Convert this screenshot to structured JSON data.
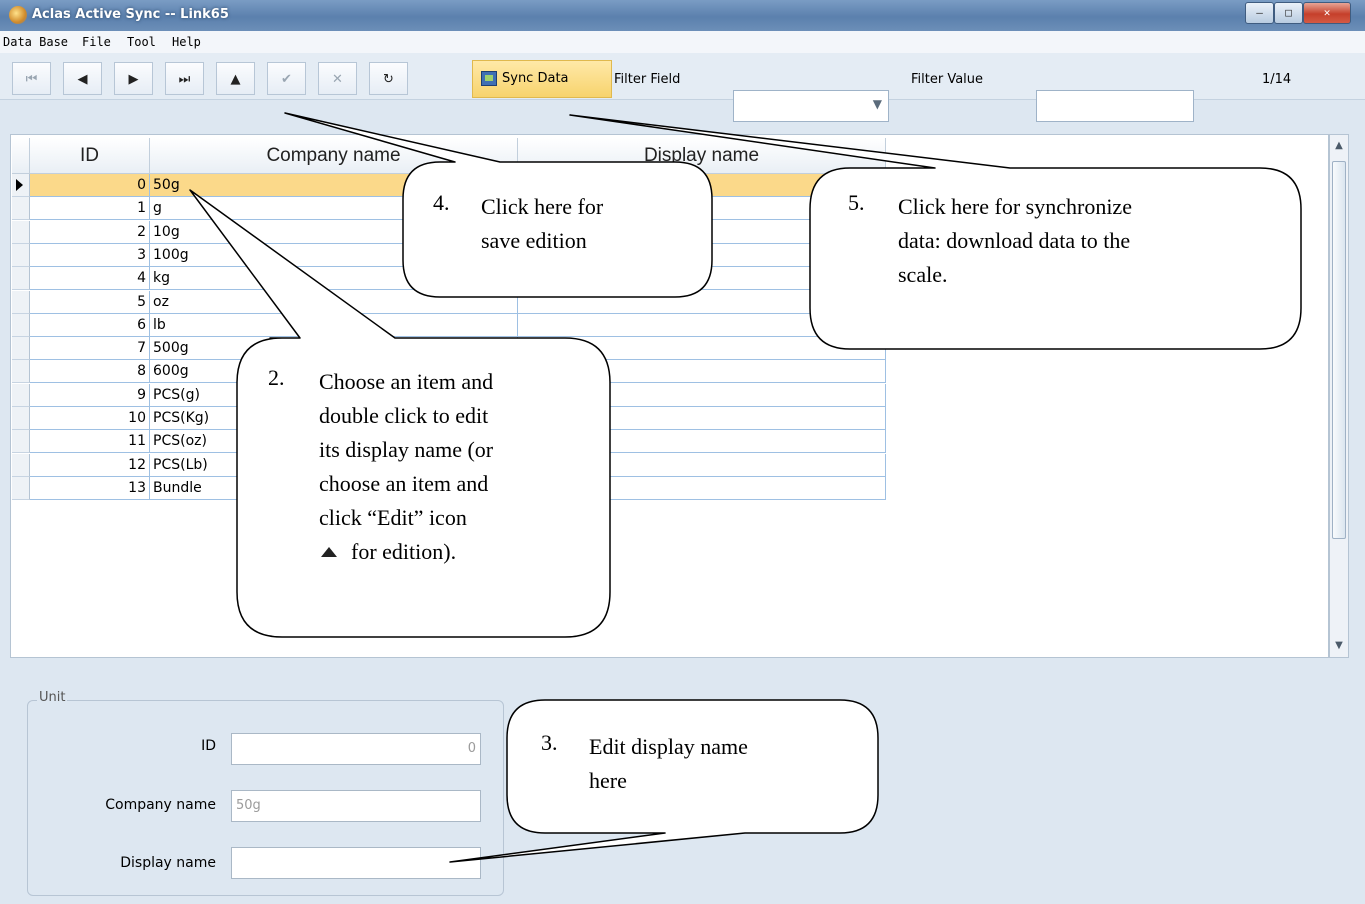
{
  "window": {
    "title": "Aclas Active Sync -- Link65",
    "buttons": [
      "–",
      "□",
      "✕"
    ]
  },
  "menu": [
    "Data Base",
    "File",
    "Tool",
    "Help"
  ],
  "toolbar": {
    "nav_icons": [
      "first-icon",
      "prev-icon",
      "next-icon",
      "last-icon",
      "edit-up-icon",
      "save-check-icon",
      "cancel-x-icon",
      "refresh-icon"
    ],
    "nav_glyphs": [
      "⏮",
      "◀",
      "▶",
      "⏭",
      "▲",
      "✔",
      "✕",
      "↻"
    ],
    "sync_label": "Sync Data",
    "filter_field_label": "Filter Field",
    "filter_field_value": "",
    "filter_value_label": "Filter Value",
    "filter_value": "",
    "record_position": "1/14"
  },
  "grid": {
    "columns": [
      "ID",
      "Company name",
      "Display name"
    ],
    "rows": [
      {
        "id": "0",
        "company": "50g",
        "display": ""
      },
      {
        "id": "1",
        "company": "g",
        "display": ""
      },
      {
        "id": "2",
        "company": "10g",
        "display": ""
      },
      {
        "id": "3",
        "company": "100g",
        "display": ""
      },
      {
        "id": "4",
        "company": "kg",
        "display": ""
      },
      {
        "id": "5",
        "company": "oz",
        "display": ""
      },
      {
        "id": "6",
        "company": "lb",
        "display": ""
      },
      {
        "id": "7",
        "company": "500g",
        "display": ""
      },
      {
        "id": "8",
        "company": "600g",
        "display": ""
      },
      {
        "id": "9",
        "company": "PCS(g)",
        "display": ""
      },
      {
        "id": "10",
        "company": "PCS(Kg)",
        "display": ""
      },
      {
        "id": "11",
        "company": "PCS(oz)",
        "display": ""
      },
      {
        "id": "12",
        "company": "PCS(Lb)",
        "display": ""
      },
      {
        "id": "13",
        "company": "Bundle",
        "display": ""
      }
    ],
    "selected_index": 0
  },
  "detail": {
    "group_title": "Unit",
    "id_label": "ID",
    "id_value": "0",
    "company_label": "Company name",
    "company_value": "50g",
    "display_label": "Display name",
    "display_value": ""
  },
  "callouts": {
    "step2": {
      "num": "2.",
      "lines": [
        "Choose an item and",
        "double click to edit",
        "its display name (or",
        "choose an item and",
        "click “Edit” icon",
        "for edition)."
      ]
    },
    "step3": {
      "num": "3.",
      "lines": [
        "Edit display name",
        "here"
      ]
    },
    "step4": {
      "num": "4.",
      "lines": [
        "Click here for",
        "save edition"
      ]
    },
    "step5": {
      "num": "5.",
      "lines": [
        "Click here for synchronize",
        "data: download data to the",
        "scale."
      ]
    }
  }
}
